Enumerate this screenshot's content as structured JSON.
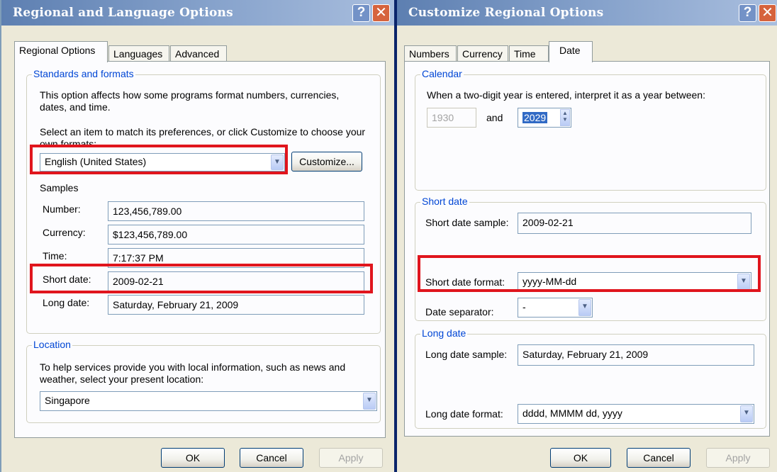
{
  "left": {
    "title": "Regional and Language Options",
    "tabs": [
      "Regional Options",
      "Languages",
      "Advanced"
    ],
    "standards": {
      "legend": "Standards and formats",
      "desc": "This option affects how some programs format numbers, currencies, dates, and time.",
      "select_prompt": "Select an item to match its preferences, or click Customize to choose your own formats:",
      "format_value": "English (United States)",
      "customize_label": "Customize...",
      "samples_label": "Samples",
      "number_label": "Number:",
      "number_value": "123,456,789.00",
      "currency_label": "Currency:",
      "currency_value": "$123,456,789.00",
      "time_label": "Time:",
      "time_value": "7:17:37 PM",
      "short_date_label": "Short date:",
      "short_date_value": "2009-02-21",
      "long_date_label": "Long date:",
      "long_date_value": "Saturday, February 21, 2009"
    },
    "location": {
      "legend": "Location",
      "desc": "To help services provide you with local information, such as news and weather, select your present location:",
      "value": "Singapore"
    },
    "buttons": {
      "ok": "OK",
      "cancel": "Cancel",
      "apply": "Apply"
    }
  },
  "right": {
    "title": "Customize Regional Options",
    "tabs": [
      "Numbers",
      "Currency",
      "Time",
      "Date"
    ],
    "calendar": {
      "legend": "Calendar",
      "desc": "When a two-digit year is entered, interpret it as a year between:",
      "from_year": "1930",
      "and_label": "and",
      "to_year": "2029"
    },
    "short_date": {
      "legend": "Short date",
      "sample_label": "Short date sample:",
      "sample_value": "2009-02-21",
      "format_label": "Short date format:",
      "format_value": "yyyy-MM-dd",
      "separator_label": "Date separator:",
      "separator_value": "-"
    },
    "long_date": {
      "legend": "Long date",
      "sample_label": "Long date sample:",
      "sample_value": "Saturday, February 21, 2009",
      "format_label": "Long date format:",
      "format_value": "dddd, MMMM dd, yyyy"
    },
    "buttons": {
      "ok": "OK",
      "cancel": "Cancel",
      "apply": "Apply"
    }
  },
  "icons": {
    "help": "?",
    "close": "✕",
    "dropdown": "▼",
    "spin_up": "▲",
    "spin_down": "▼"
  },
  "colors": {
    "highlight": "#e0151d",
    "legend": "#0046d5",
    "title_start": "#5d7fb1",
    "selection": "#316ac5"
  }
}
